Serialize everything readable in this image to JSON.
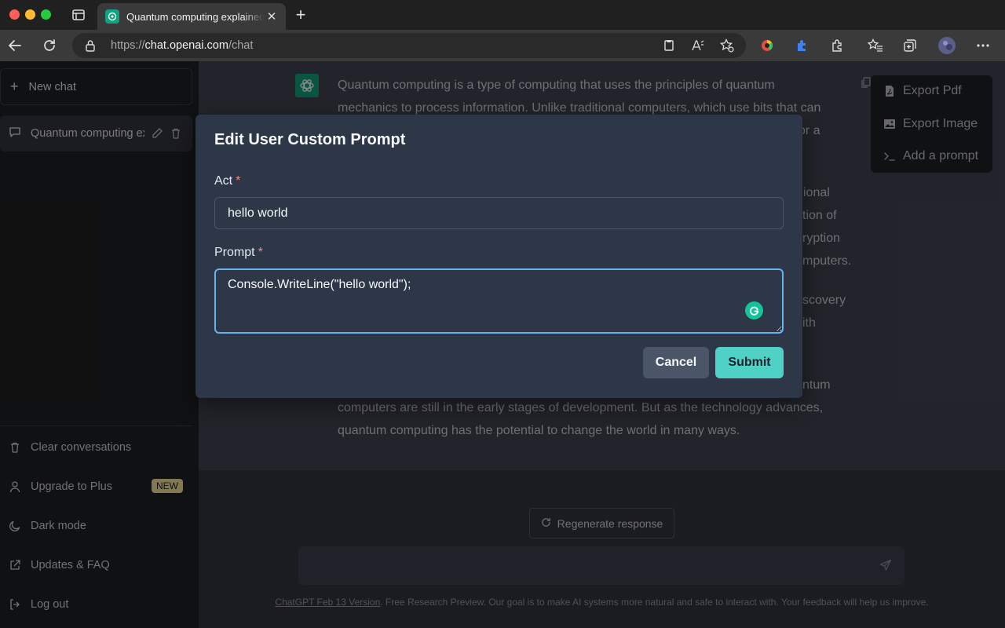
{
  "browser": {
    "tab_title": "Quantum computing explained",
    "tab_close": "✕",
    "new_tab": "+",
    "url_prefix": "https://",
    "url_host": "chat.openai.com",
    "url_path": "/chat"
  },
  "sidebar": {
    "new_chat_label": "New chat",
    "conversation_title": "Quantum computing explained",
    "bottom_items": [
      {
        "label": "Clear conversations",
        "icon": "trash-icon"
      },
      {
        "label": "Upgrade to Plus",
        "icon": "user-icon",
        "badge": "NEW"
      },
      {
        "label": "Dark mode",
        "icon": "moon-icon"
      },
      {
        "label": "Updates & FAQ",
        "icon": "external-link-icon"
      },
      {
        "label": "Log out",
        "icon": "logout-icon"
      }
    ]
  },
  "message": {
    "lines": [
      "Quantum computing is a type of computing that uses the principles of quantum",
      "mechanics to process information. Unlike traditional computers, which use bits that can",
      "or a",
      "ional",
      "tion of",
      "ryption",
      "mputers.",
      "scovery",
      "ith",
      "ntum",
      "computers are still in the early stages of development. But as the technology advances,",
      "quantum computing has the potential to change the world in many ways."
    ]
  },
  "export_menu": {
    "items": [
      "Export Pdf",
      "Export Image",
      "Add a prompt"
    ]
  },
  "regenerate_label": "Regenerate response",
  "footer": {
    "link": "ChatGPT Feb 13 Version",
    "text": ". Free Research Preview. Our goal is to make AI systems more natural and safe to interact with. Your feedback will help us improve."
  },
  "modal": {
    "title": "Edit User Custom Prompt",
    "act_label": "Act",
    "required_mark": "*",
    "act_value": "hello world",
    "prompt_label": "Prompt",
    "prompt_value": "Console.WriteLine(\"hello world\");",
    "cancel_label": "Cancel",
    "submit_label": "Submit"
  },
  "colors": {
    "accent_submit": "#4fd1c5",
    "focus_border": "#63b3ed",
    "required": "#fc8181",
    "gpt_green": "#10a37f",
    "grammarly": "#15c39a"
  }
}
